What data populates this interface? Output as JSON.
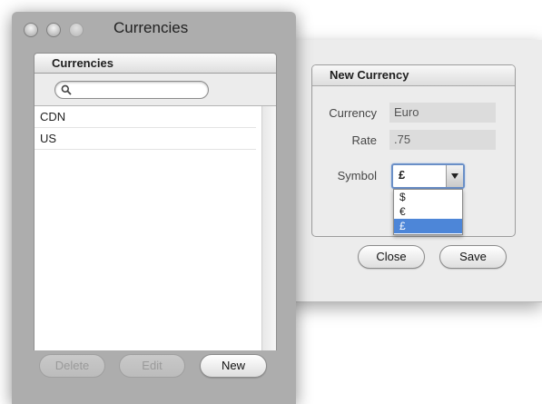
{
  "currencies_window": {
    "title": "Currencies",
    "box_title": "Currencies",
    "search": {
      "value": "",
      "placeholder": ""
    },
    "rows": [
      "CDN",
      "US"
    ],
    "buttons": {
      "delete": "Delete",
      "edit": "Edit",
      "new": "New"
    }
  },
  "new_currency": {
    "group_title": "New Currency",
    "currency_label": "Currency",
    "currency_value": "Euro",
    "rate_label": "Rate",
    "rate_value": ".75",
    "symbol_label": "Symbol",
    "symbol_selected": "£",
    "symbol_options": [
      "$",
      "€",
      "£"
    ],
    "buttons": {
      "close": "Close",
      "save": "Save"
    }
  },
  "colors": {
    "selection": "#4d86d8",
    "focus_ring": "#6a8fc7",
    "window_bg": "#adadad"
  }
}
